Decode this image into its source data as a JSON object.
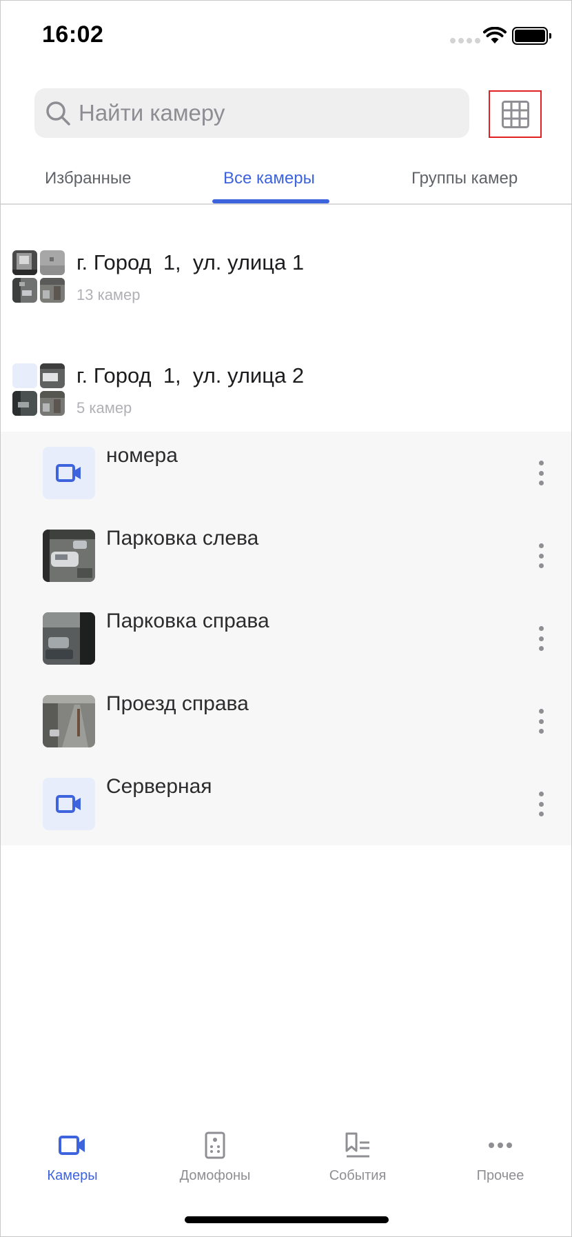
{
  "status_bar": {
    "time": "16:02"
  },
  "search": {
    "placeholder": "Найти камеру"
  },
  "tabs": [
    {
      "label": "Избранные",
      "active": false
    },
    {
      "label": "Все камеры",
      "active": true
    },
    {
      "label": "Группы камер",
      "active": false
    }
  ],
  "groups": [
    {
      "title": "г. Город  1,  ул. улица 1",
      "count": "13 камер"
    },
    {
      "title": "г. Город  1,  ул. улица 2",
      "count": "5 камер"
    }
  ],
  "cameras": [
    {
      "name": "номера",
      "thumb": "camera-icon"
    },
    {
      "name": "Парковка слева",
      "thumb": "parking-left-photo"
    },
    {
      "name": "Парковка справа",
      "thumb": "parking-right-photo"
    },
    {
      "name": "Проезд справа",
      "thumb": "driveway-right-photo"
    },
    {
      "name": "Серверная",
      "thumb": "camera-icon"
    }
  ],
  "bottom_nav": [
    {
      "label": "Камеры",
      "icon": "video-camera-icon",
      "active": true
    },
    {
      "label": "Домофоны",
      "icon": "intercom-icon",
      "active": false
    },
    {
      "label": "События",
      "icon": "events-icon",
      "active": false
    },
    {
      "label": "Прочее",
      "icon": "more-dots-icon",
      "active": false
    }
  ],
  "colors": {
    "accent": "#3d63dd",
    "list_background": "#f7f7f7",
    "highlight_border": "#e02020"
  }
}
